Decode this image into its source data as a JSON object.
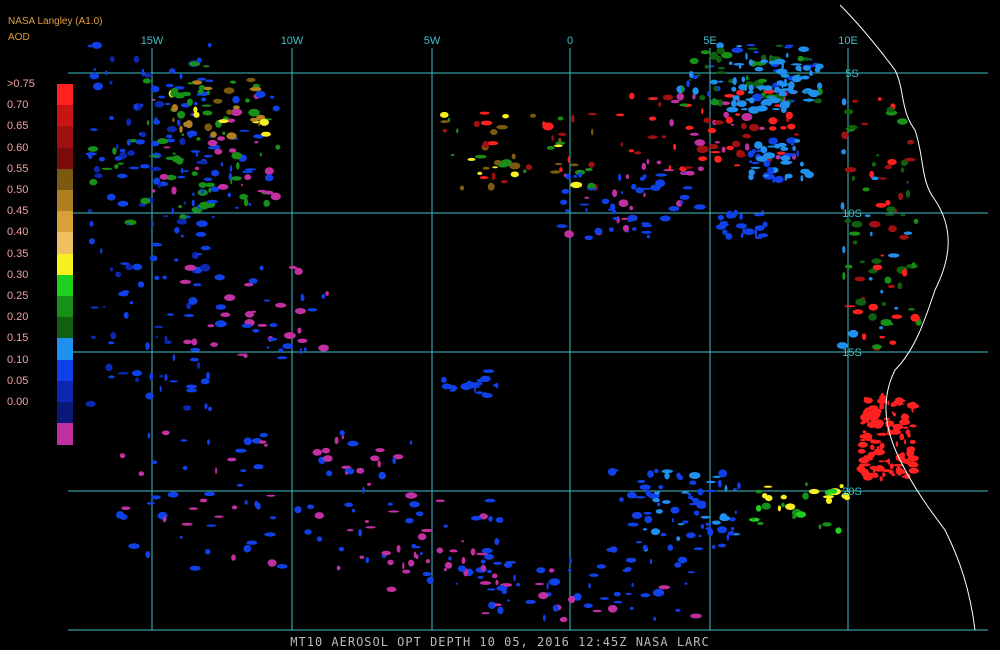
{
  "header": {
    "product": "NASA Langley (A1.0)",
    "unit": "AOD"
  },
  "legend": {
    "labels": [
      ">0.75",
      "0.70",
      "0.65",
      "0.60",
      "0.55",
      "0.50",
      "0.45",
      "0.40",
      "0.35",
      "0.30",
      "0.25",
      "0.20",
      "0.15",
      "0.10",
      "0.05",
      "0.00"
    ],
    "colors": [
      "#ff2020",
      "#c81414",
      "#a01010",
      "#780c0c",
      "#7a5a10",
      "#b08020",
      "#d8a038",
      "#f0c060",
      "#f8f020",
      "#20d020",
      "#189018",
      "#106010",
      "#2090f0",
      "#1040e8",
      "#0c28b0",
      "#0a1878",
      "#c030a0"
    ]
  },
  "grid": {
    "lon_labels": [
      "15W",
      "10W",
      "5W",
      "0",
      "5E",
      "10E"
    ],
    "lat_labels": [
      "5S",
      "10S",
      "15S",
      "20S"
    ],
    "color": "#40c0c8"
  },
  "footer": {
    "caption": "MT10  AEROSOL OPT DEPTH   10 05, 2016 12:45Z   NASA LARC"
  }
}
